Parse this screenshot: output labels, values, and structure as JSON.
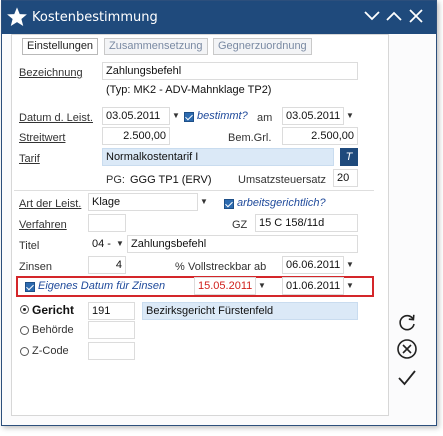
{
  "window": {
    "title": "Kostenbestimmung"
  },
  "tabs": [
    {
      "label": "Einstellungen"
    },
    {
      "label": "Zusammensetzung"
    },
    {
      "label": "Gegnerzuordnung"
    }
  ],
  "form": {
    "bezeichnung": {
      "label": "Bezeichnung",
      "value": "Zahlungsbefehl",
      "type_note": "(Typ: MK2 - ADV-Mahnklage TP2)"
    },
    "datum": {
      "label": "Datum d. Leist.",
      "value": "03.05.2011",
      "bestimmt_label": "bestimmt?",
      "am_label": "am",
      "am_value": "03.05.2011"
    },
    "streitwert": {
      "label": "Streitwert",
      "value": "2.500,00",
      "bem_label": "Bem.Grl.",
      "bem_value": "2.500,00"
    },
    "tarif": {
      "label": "Tarif",
      "value": "Normalkostentarif I",
      "button": "T",
      "pg_label": "PG:",
      "pg_value": "GGG TP1 (ERV)",
      "ust_label": "Umsatzsteuersatz",
      "ust_value": "20"
    },
    "art": {
      "label": "Art der Leist.",
      "value": "Klage",
      "arbeits_label": "arbeitsgerichtlich?"
    },
    "verfahren": {
      "label": "Verfahren",
      "value": "",
      "gz_label": "GZ",
      "gz_value": "15 C 158/11d"
    },
    "titel": {
      "label": "Titel",
      "code": "04 -",
      "value": "Zahlungsbefehl"
    },
    "zinsen": {
      "label": "Zinsen",
      "value": "4",
      "pct": "%",
      "vollstreckbar_label": "Vollstreckbar ab",
      "vollstreckbar_value": "06.06.2011"
    },
    "eigenes": {
      "label": "Eigenes Datum für Zinsen",
      "date1": "15.05.2011",
      "date2": "01.06.2011"
    },
    "gericht": {
      "label": "Gericht",
      "code": "191",
      "name": "Bezirksgericht Fürstenfeld"
    },
    "behoerde": {
      "label": "Behörde"
    },
    "zcode": {
      "label": "Z-Code"
    }
  },
  "colors": {
    "titlebar": "#1f4a7c",
    "accent": "#2d6bb0",
    "highlight": "#d4262a",
    "date_red": "#d0201c"
  }
}
